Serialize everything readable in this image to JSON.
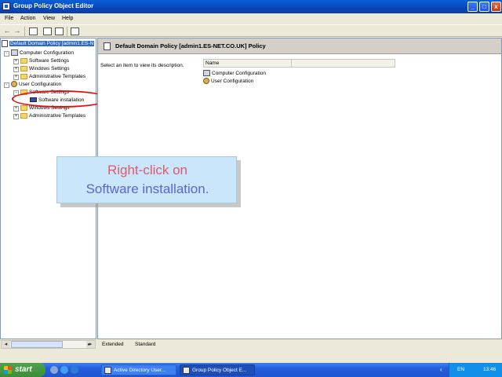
{
  "window": {
    "title": "Group Policy Object Editor",
    "controls": {
      "minimize": "_",
      "maximize": "□",
      "close": "x"
    }
  },
  "menu": {
    "file": "File",
    "action": "Action",
    "view": "View",
    "help": "Help"
  },
  "toolbar": {
    "back": "←",
    "forward": "→"
  },
  "tree": {
    "root": "Default Domain Policy [admin1.ES-N",
    "computer_config": "Computer Configuration",
    "cc_software": "Software Settings",
    "cc_windows": "Windows Settings",
    "cc_admin": "Administrative Templates",
    "user_config": "User Configuration",
    "uc_software": "Software Settings",
    "uc_software_installation": "Software installation",
    "uc_windows": "Windows Settings",
    "uc_admin": "Administrative Templates",
    "expand_plus": "+",
    "expand_minus": "-"
  },
  "right_pane": {
    "header": "Default Domain Policy [admin1.ES-NET.CO.UK] Policy",
    "description": "Select an item to view its description.",
    "column_name": "Name",
    "items": [
      "Computer Configuration",
      "User Configuration"
    ]
  },
  "tabs": {
    "extended": "Extended",
    "standard": "Standard"
  },
  "callout": {
    "line1": "Right-click on",
    "line2": "Software installation."
  },
  "taskbar": {
    "start": "start",
    "tasks": [
      "Active Directory User...",
      "Group Policy Object E..."
    ],
    "lang": "EN",
    "clock": "13:46"
  },
  "colors": {
    "titlebar": "#0a5fd8",
    "highlight_circle": "#e01010",
    "callout_bg": "#c9e6fa",
    "callout_line1": "#e0596d",
    "callout_line2": "#5c64d6"
  }
}
